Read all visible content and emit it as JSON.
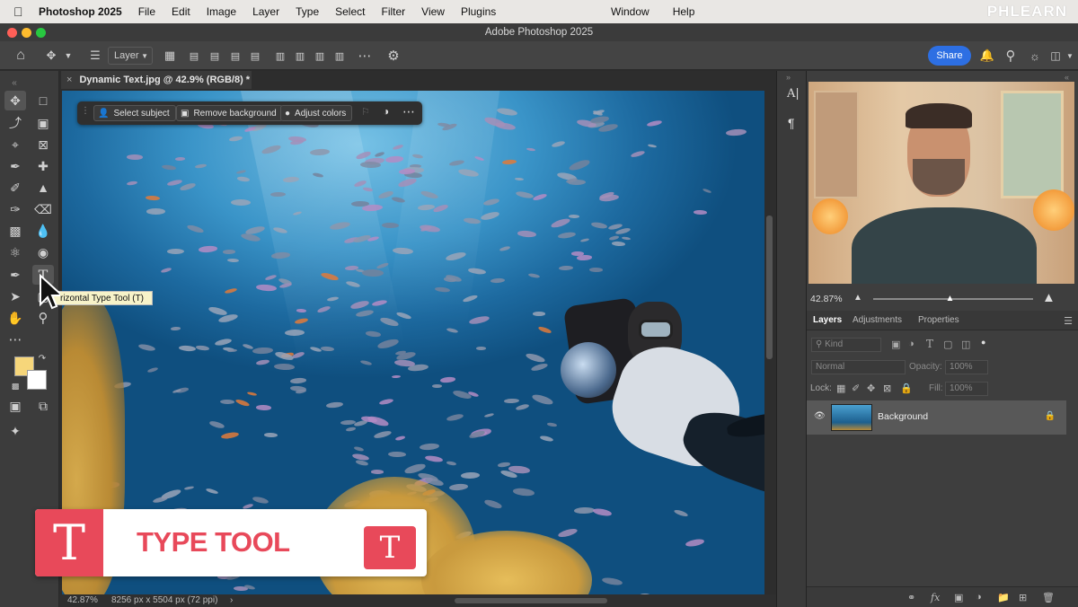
{
  "menubar": {
    "app_name": "Photoshop 2025",
    "items_left": [
      "File",
      "Edit",
      "Image",
      "Layer",
      "Type",
      "Select",
      "Filter",
      "View",
      "Plugins"
    ],
    "items_right": [
      "Window",
      "Help"
    ],
    "watermark": "PHLEARN"
  },
  "window": {
    "title": "Adobe Photoshop 2025"
  },
  "options_bar": {
    "layer_select": "Layer",
    "share_label": "Share"
  },
  "document": {
    "tab_title": "Dynamic Text.jpg @ 42.9% (RGB/8) *",
    "tab_close": "×"
  },
  "context_bar": {
    "select_subject": "Select subject",
    "remove_background": "Remove background",
    "adjust_colors": "Adjust colors"
  },
  "tooltip": {
    "text": "rizontal Type Tool (T)"
  },
  "banner": {
    "letter": "T",
    "label": "TYPE TOOL",
    "small_letter": "T"
  },
  "status_bar": {
    "zoom": "42.87%",
    "doc_info": "8256 px x 5504 px (72 ppi)",
    "arrow": "›"
  },
  "navigator": {
    "zoom": "42.87%",
    "zoom_level": 0.48
  },
  "layers_panel": {
    "tabs": [
      "Layers",
      "Adjustments",
      "Properties"
    ],
    "filter_placeholder": "Kind",
    "blend_mode": "Normal",
    "opacity_label": "Opacity:",
    "opacity_value": "100%",
    "lock_label": "Lock:",
    "fill_label": "Fill:",
    "fill_value": "100%",
    "layer_name": "Background"
  },
  "colors": {
    "foreground": "#f6d67a",
    "background": "#ffffff",
    "accent": "#e8495a",
    "share_blue": "#2d6fe3"
  }
}
